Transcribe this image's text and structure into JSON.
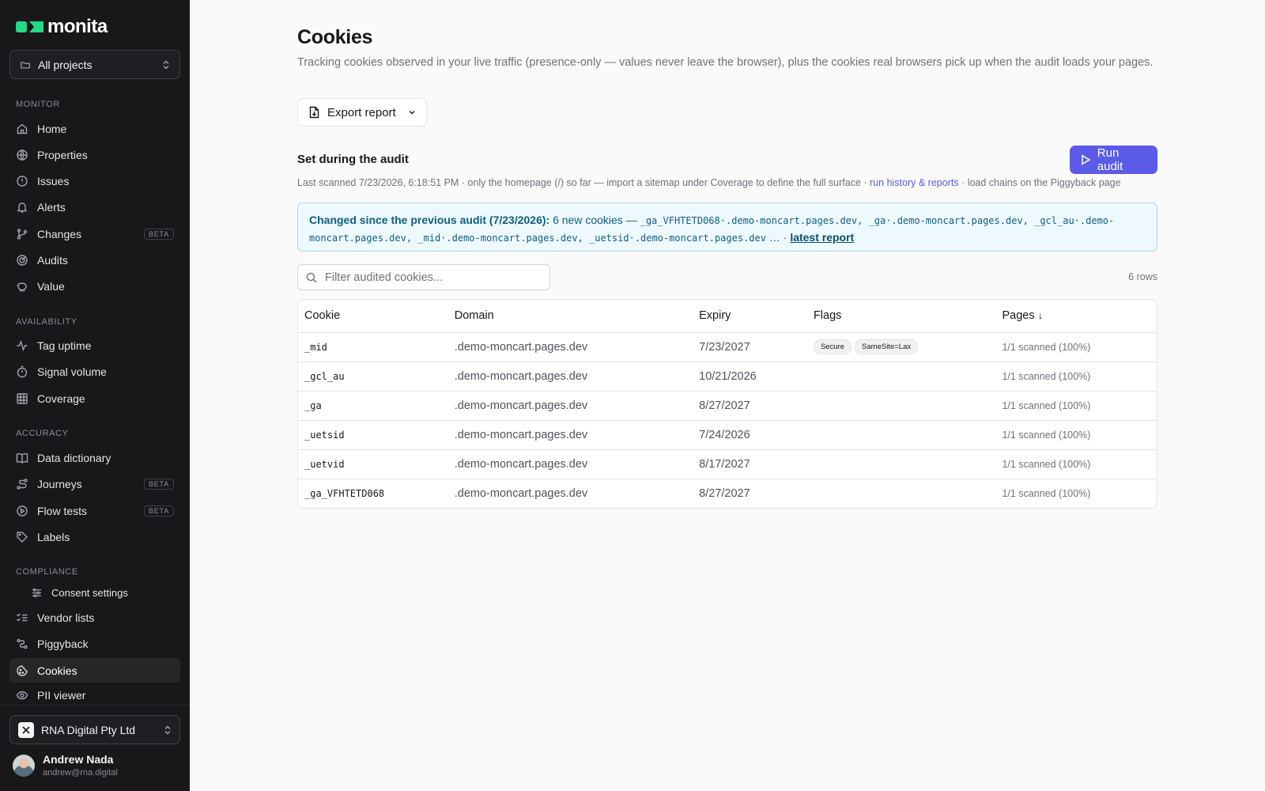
{
  "app": {
    "name": "monita"
  },
  "sidebar": {
    "project_select": "All projects",
    "sections": {
      "monitor": "MONITOR",
      "availability": "AVAILABILITY",
      "accuracy": "ACCURACY",
      "compliance": "COMPLIANCE"
    },
    "items": {
      "home": "Home",
      "properties": "Properties",
      "issues": "Issues",
      "alerts": "Alerts",
      "changes": "Changes",
      "audits": "Audits",
      "value": "Value",
      "tag_uptime": "Tag uptime",
      "signal_volume": "Signal volume",
      "coverage": "Coverage",
      "data_dictionary": "Data dictionary",
      "journeys": "Journeys",
      "flow_tests": "Flow tests",
      "labels": "Labels",
      "consent_settings": "Consent settings",
      "vendor_lists": "Vendor lists",
      "piggyback": "Piggyback",
      "cookies": "Cookies",
      "pii_viewer": "PII viewer"
    },
    "beta_badge": "BETA",
    "org": "RNA Digital Pty Ltd",
    "user": {
      "name": "Andrew Nada",
      "email": "andrew@rna.digital"
    }
  },
  "page": {
    "title": "Cookies",
    "description": "Tracking cookies observed in your live traffic (presence-only — values never leave the browser), plus the cookies real browsers pick up when the audit loads your pages.",
    "export_button": "Export report",
    "section_title": "Set during the audit",
    "run_audit_button": "Run audit",
    "scan_meta_prefix": "Last scanned 7/23/2026, 6:18:51 PM · only the homepage (/) so far — import a sitemap under Coverage to define the full surface ·",
    "scan_meta_link": "run history & reports",
    "scan_meta_suffix": "· load chains on the Piggyback page",
    "changed": {
      "label": "Changed since the previous audit (7/23/2026):",
      "count_text": "6 new cookies —",
      "cookies_list": "_ga_VFHTETD068·.demo-moncart.pages.dev, _ga·.demo-moncart.pages.dev, _gcl_au·.demo-moncart.pages.dev, _mid·.demo-moncart.pages.dev, _uetsid·.demo-moncart.pages.dev",
      "ellipsis": "… ·",
      "link": "latest report"
    },
    "filter_placeholder": "Filter audited cookies...",
    "rows_count": "6 rows"
  },
  "table": {
    "headers": {
      "cookie": "Cookie",
      "domain": "Domain",
      "expiry": "Expiry",
      "flags": "Flags",
      "pages": "Pages"
    },
    "rows": [
      {
        "cookie": "_mid",
        "domain": ".demo-moncart.pages.dev",
        "expiry": "7/23/2027",
        "flag1": "Secure",
        "flag2": "SameSite=Lax",
        "pages": "1/1 scanned (100%)"
      },
      {
        "cookie": "_gcl_au",
        "domain": ".demo-moncart.pages.dev",
        "expiry": "10/21/2026",
        "pages": "1/1 scanned (100%)"
      },
      {
        "cookie": "_ga",
        "domain": ".demo-moncart.pages.dev",
        "expiry": "8/27/2027",
        "pages": "1/1 scanned (100%)"
      },
      {
        "cookie": "_uetsid",
        "domain": ".demo-moncart.pages.dev",
        "expiry": "7/24/2026",
        "pages": "1/1 scanned (100%)"
      },
      {
        "cookie": "_uetvid",
        "domain": ".demo-moncart.pages.dev",
        "expiry": "8/17/2027",
        "pages": "1/1 scanned (100%)"
      },
      {
        "cookie": "_ga_VFHTETD068",
        "domain": ".demo-moncart.pages.dev",
        "expiry": "8/27/2027",
        "pages": "1/1 scanned (100%)"
      }
    ]
  },
  "colors": {
    "accent": "#5b5bea",
    "brand_green": "#22d98a",
    "sidebar_bg": "#18181b",
    "info_bg": "#eef9fd",
    "info_border": "#a5d8ec"
  }
}
